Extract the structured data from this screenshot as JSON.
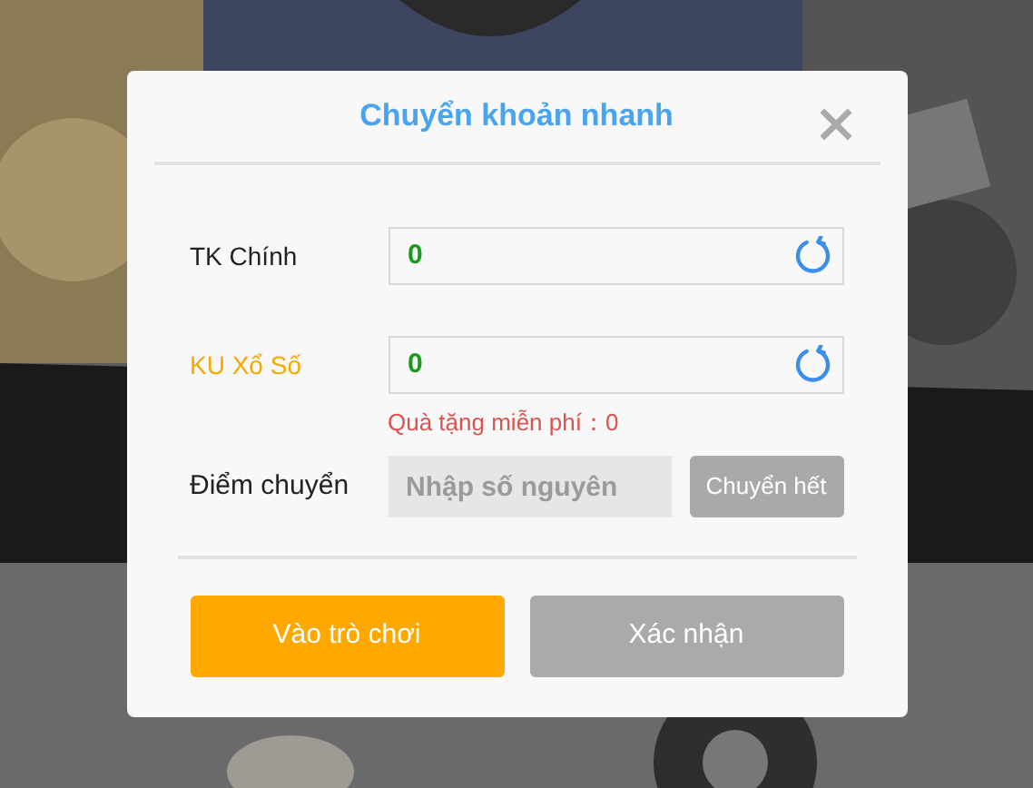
{
  "dialog": {
    "title": "Chuyển khoản nhanh",
    "accounts": [
      {
        "label": "TK Chính",
        "value": "0",
        "highlighted": false
      },
      {
        "label": "KU Xổ Số",
        "value": "0",
        "highlighted": true
      }
    ],
    "gift_note": "Quà tặng miễn phí：0",
    "transfer": {
      "label": "Điểm chuyển",
      "placeholder": "Nhập số nguyên",
      "button": "Chuyển hết"
    },
    "buttons": [
      {
        "label": "Vào trò chơi",
        "kind": "primary"
      },
      {
        "label": "Xác nhận",
        "kind": "secondary"
      }
    ]
  }
}
